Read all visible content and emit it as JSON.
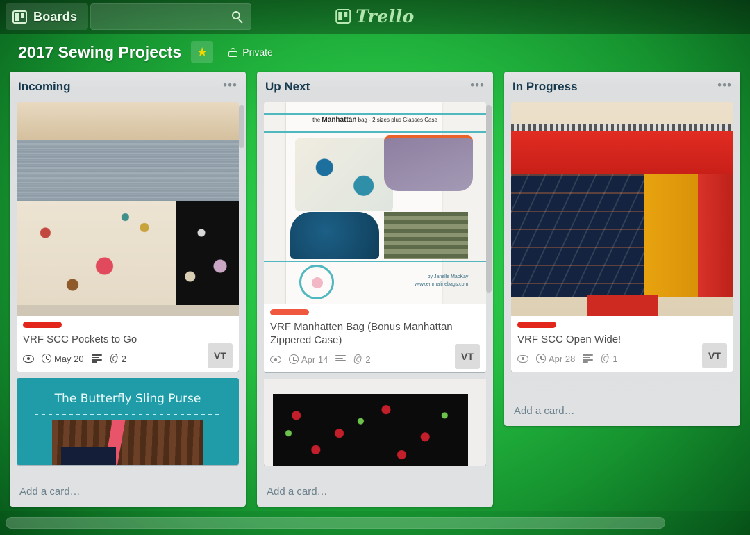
{
  "topbar": {
    "boards_label": "Boards",
    "boards_icon": "board-grid-icon",
    "search_value": "",
    "search_placeholder": "",
    "search_icon": "search-icon",
    "logo_text": "Trello",
    "logo_icon": "trello-board-icon"
  },
  "board_header": {
    "title": "2017 Sewing Projects",
    "star_icon": "star-icon",
    "star_glyph": "★",
    "privacy_label": "Private",
    "privacy_icon": "lock-icon"
  },
  "colors": {
    "background_green": "#22c03e",
    "label_red": "#eb4d3d",
    "label_red_soft": "#f05a46",
    "list_background": "#dfe1e3",
    "card_white": "#ffffff",
    "title_text": "#4d4d4d",
    "badge_text": "#8c8c8c",
    "avatar_background": "#dcdcdc"
  },
  "lists": [
    {
      "title": "Incoming",
      "menu_glyph": "•••",
      "add_card_label": "Add a card…",
      "cards": [
        {
          "label_color": "#e2261c",
          "title": "VRF SCC Pockets to Go",
          "due": "May 20",
          "attachments": "2",
          "avatar": "VT",
          "cover": "sewing-notions-zipper-pouch"
        },
        {
          "cover": "butterfly-sling-purse-banner",
          "cover_text": "The Butterfly Sling Purse"
        }
      ]
    },
    {
      "title": "Up Next",
      "menu_glyph": "•••",
      "add_card_label": "Add a card…",
      "cards": [
        {
          "label_color": "#f0573f",
          "title": "VRF Manhatten Bag (Bonus Manhattan Zippered Case)",
          "due": "Apr 14",
          "attachments": "2",
          "avatar": "VT",
          "cover": "manhattan-bag-pattern-cover",
          "cover_title_prefix": "the ",
          "cover_title_brand": "Manhattan",
          "cover_title_suffix": " bag - 2 sizes plus Glasses Case",
          "cover_byline": "by Janelle MacKay",
          "cover_url": "www.emmalinebags.com"
        },
        {
          "cover": "cherry-print-fabric"
        }
      ]
    },
    {
      "title": "In Progress",
      "menu_glyph": "•••",
      "add_card_label": "Add a card…",
      "cards": [
        {
          "label_color": "#e2261c",
          "title": "VRF SCC Open Wide!",
          "due": "Apr 28",
          "attachments": "1",
          "avatar": "VT",
          "cover": "arrow-print-fabric-red-zipper"
        }
      ]
    }
  ],
  "scrollbar": {
    "horizontal_icon": "horizontal-scrollbar"
  }
}
